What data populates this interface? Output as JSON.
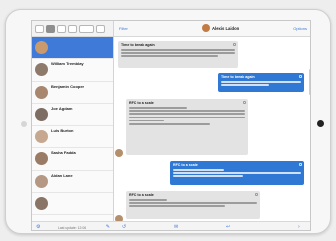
{
  "chat": {
    "back_label": "Filter",
    "contact_name": "Alexis Laidon",
    "options_label": "Options",
    "messages": [
      {
        "direction": "in",
        "title": "Time to break again"
      },
      {
        "direction": "out",
        "title": "Time to break again"
      },
      {
        "direction": "in",
        "title": "RFC to a scale"
      },
      {
        "direction": "out",
        "title": "RFC to a scale"
      },
      {
        "direction": "in",
        "title": "RFC to a scale"
      }
    ]
  },
  "sidebar": {
    "items": [
      {
        "name": "",
        "preview": "",
        "active": true
      },
      {
        "name": "William Tremblay",
        "preview": "",
        "active": false
      },
      {
        "name": "Benjamin Cooper",
        "preview": "",
        "active": false
      },
      {
        "name": "Joe Agdam",
        "preview": "",
        "active": false
      },
      {
        "name": "Luis Burton",
        "preview": "",
        "active": false
      },
      {
        "name": "Sasha Fadda",
        "preview": "",
        "active": false
      },
      {
        "name": "Aidan Lane",
        "preview": "",
        "active": false
      },
      {
        "name": "",
        "preview": "",
        "active": false
      }
    ],
    "footer_status": "Last update: 12:06"
  },
  "colors": {
    "accent": "#3f7ad8",
    "outgoing_bubble": "#2f79d4",
    "incoming_bubble": "#e3e3e3"
  },
  "icons": {
    "footer_left": "cog-icon",
    "footer_right": "compose-icon",
    "chat_footer": [
      "undo-icon",
      "attach-icon",
      "reply-icon",
      "forward-icon"
    ]
  }
}
